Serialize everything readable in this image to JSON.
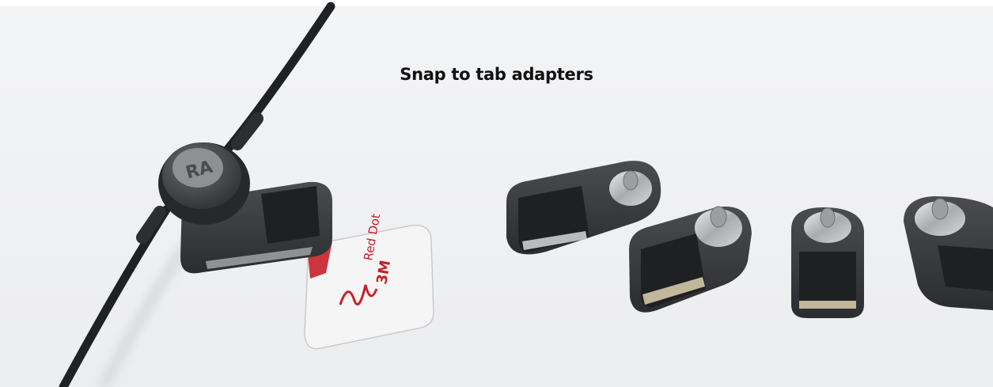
{
  "page": {
    "title": "Snap to tab adapters"
  },
  "hub": {
    "badge": "RA"
  },
  "electrode_label": {
    "brand": "3M",
    "product": "Red Dot"
  },
  "colors": {
    "background": "#eeeff1",
    "device": "#3b3d40",
    "device_dark": "#24262a",
    "metal": "#c7c8ca",
    "label_red": "#c8202a",
    "heading": "#111111"
  },
  "icons": {
    "hub": "round-hub-icon",
    "electrode": "electrode-tab-icon",
    "adapter": "snap-adapter-icon"
  }
}
